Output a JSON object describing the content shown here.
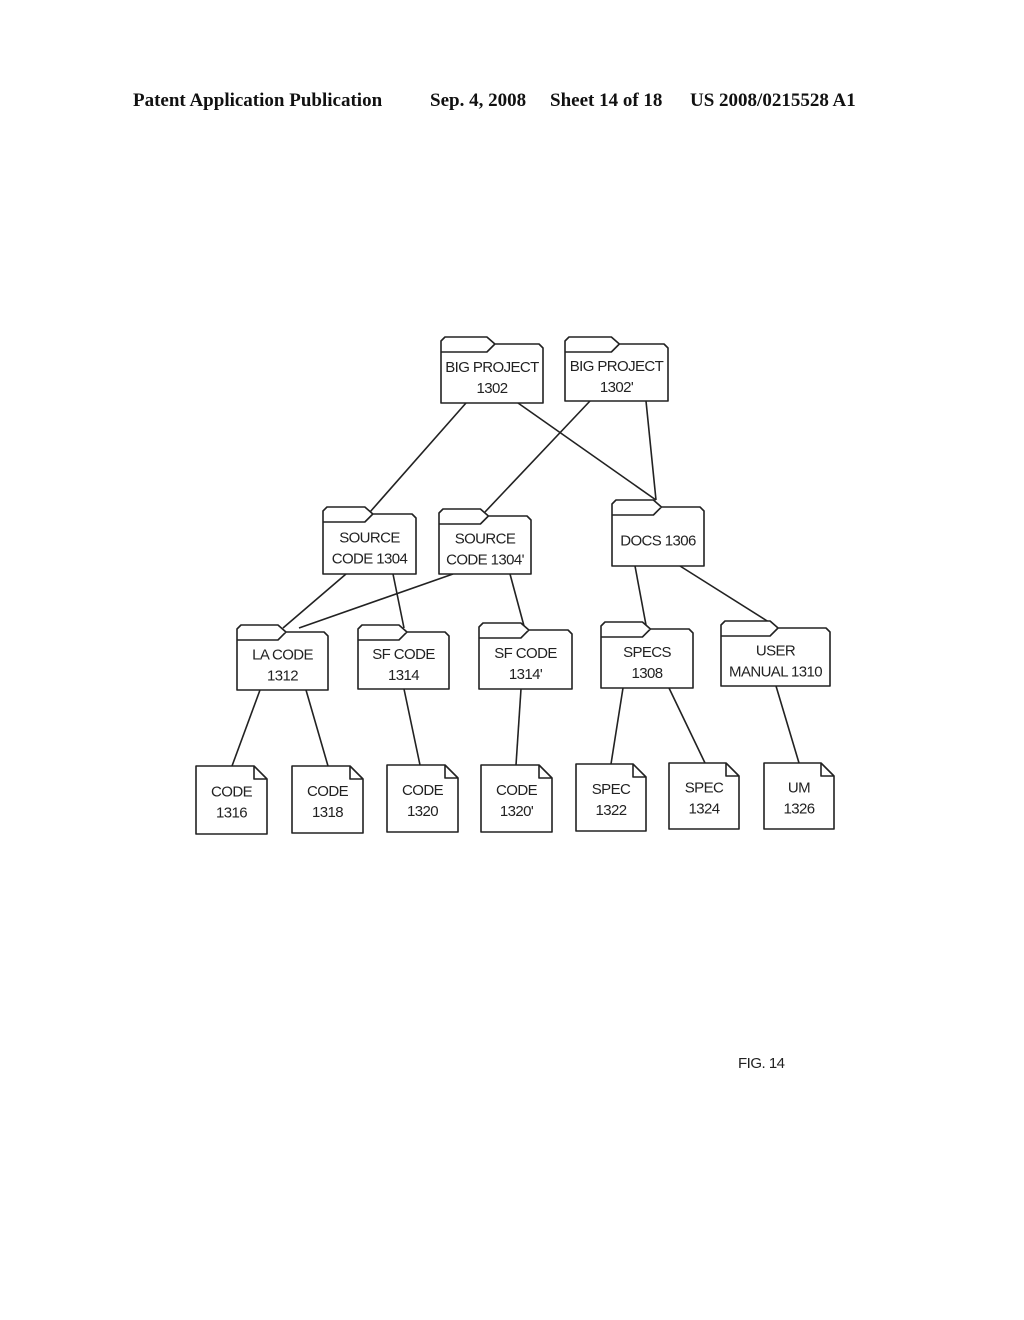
{
  "header": {
    "publication": "Patent Application Publication",
    "date": "Sep. 4, 2008",
    "sheet": "Sheet 14 of 18",
    "number": "US 2008/0215528 A1"
  },
  "figure_label": "FIG. 14",
  "nodes": [
    {
      "id": "bp1302",
      "type": "folder",
      "lines": [
        "BIG PROJECT",
        "1302"
      ]
    },
    {
      "id": "bp1302p",
      "type": "folder",
      "lines": [
        "BIG PROJECT",
        "1302'"
      ]
    },
    {
      "id": "sc1304",
      "type": "folder",
      "lines": [
        "SOURCE",
        "CODE 1304"
      ]
    },
    {
      "id": "sc1304p",
      "type": "folder",
      "lines": [
        "SOURCE",
        "CODE 1304'"
      ]
    },
    {
      "id": "docs1306",
      "type": "folder",
      "lines": [
        "DOCS 1306"
      ]
    },
    {
      "id": "la1312",
      "type": "folder",
      "lines": [
        "LA CODE",
        "1312"
      ]
    },
    {
      "id": "sf1314",
      "type": "folder",
      "lines": [
        "SF CODE",
        "1314"
      ]
    },
    {
      "id": "sf1314p",
      "type": "folder",
      "lines": [
        "SF CODE",
        "1314'"
      ]
    },
    {
      "id": "specs1308",
      "type": "folder",
      "lines": [
        "SPECS",
        "1308"
      ]
    },
    {
      "id": "um1310",
      "type": "folder",
      "lines": [
        "USER",
        "MANUAL 1310"
      ]
    },
    {
      "id": "code1316",
      "type": "file",
      "lines": [
        "CODE",
        "1316"
      ]
    },
    {
      "id": "code1318",
      "type": "file",
      "lines": [
        "CODE",
        "1318"
      ]
    },
    {
      "id": "code1320",
      "type": "file",
      "lines": [
        "CODE",
        "1320"
      ]
    },
    {
      "id": "code1320p",
      "type": "file",
      "lines": [
        "CODE",
        "1320'"
      ]
    },
    {
      "id": "spec1322",
      "type": "file",
      "lines": [
        "SPEC",
        "1322"
      ]
    },
    {
      "id": "spec1324",
      "type": "file",
      "lines": [
        "SPEC",
        "1324"
      ]
    },
    {
      "id": "um1326",
      "type": "file",
      "lines": [
        "UM",
        "1326"
      ]
    }
  ],
  "edges": [
    [
      "bp1302",
      "sc1304"
    ],
    [
      "bp1302",
      "docs1306"
    ],
    [
      "bp1302p",
      "sc1304p"
    ],
    [
      "bp1302p",
      "docs1306"
    ],
    [
      "sc1304",
      "la1312"
    ],
    [
      "sc1304",
      "sf1314"
    ],
    [
      "sc1304p",
      "la1312"
    ],
    [
      "sc1304p",
      "sf1314p"
    ],
    [
      "docs1306",
      "specs1308"
    ],
    [
      "docs1306",
      "um1310"
    ],
    [
      "la1312",
      "code1316"
    ],
    [
      "la1312",
      "code1318"
    ],
    [
      "sf1314",
      "code1320"
    ],
    [
      "sf1314p",
      "code1320p"
    ],
    [
      "specs1308",
      "spec1322"
    ],
    [
      "specs1308",
      "spec1324"
    ],
    [
      "um1310",
      "um1326"
    ]
  ]
}
